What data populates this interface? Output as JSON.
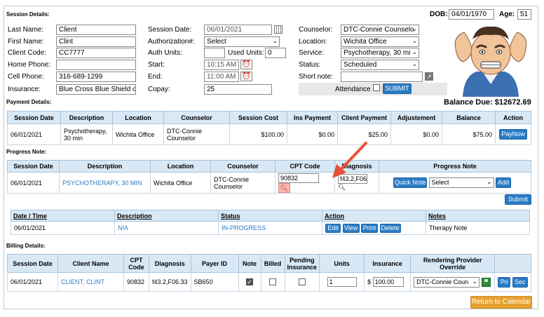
{
  "session": {
    "section_title": "Session Details:",
    "dob_label": "DOB:",
    "dob": "04/01/1970",
    "age_label": "Age:",
    "age": "51",
    "last_name_label": "Last Name:",
    "last_name": "Client",
    "first_name_label": "First Name:",
    "first_name": "Clint",
    "client_code_label": "Client Code:",
    "client_code": "CC7777",
    "home_phone_label": "Home Phone:",
    "home_phone": "",
    "cell_phone_label": "Cell Phone:",
    "cell_phone": "316-689-1299",
    "insurance_label": "Insurance:",
    "insurance": "Blue Cross Blue Shield of",
    "session_date_label": "Session Date:",
    "session_date": "06/01/2021",
    "authorization_label": "Authorization#:",
    "authorization": "Select",
    "auth_units_label": "Auth Units:",
    "auth_units": "",
    "used_units_label": "Used Units:",
    "used_units": "0",
    "start_label": "Start:",
    "start": "10:15 AM",
    "end_label": "End:",
    "end": "11:00 AM",
    "copay_label": "Copay:",
    "copay": "25",
    "counselor_label": "Counselor:",
    "counselor": "DTC-Connie Counselo",
    "location_label": "Location:",
    "location": "Wichita Office",
    "service_label": "Service:",
    "service": "Psychotherapy, 30 mi",
    "status_label": "Status:",
    "status": "Scheduled",
    "short_note_label": "Short note:",
    "short_note": "",
    "attendance_label": "Attendance",
    "submit": "SUBMIT"
  },
  "payment": {
    "section_title": "Payment Details:",
    "balance_due": "Balance Due: $12672.69",
    "headers": [
      "Session Date",
      "Description",
      "Location",
      "Counselor",
      "Session Cost",
      "Ins Payment",
      "Client Payment",
      "Adjustement",
      "Balance",
      "Action"
    ],
    "row": {
      "session_date": "06/01/2021",
      "description": "Psychotherapy, 30 min",
      "location": "Wichita Office",
      "counselor": "DTC-Connie Counselor",
      "session_cost": "$100.00",
      "ins_payment": "$0.00",
      "client_payment": "$25.00",
      "adjustment": "$0.00",
      "balance": "$75.00",
      "action": "PayNow"
    }
  },
  "progress": {
    "section_title": "Progress Note:",
    "headers": [
      "Session Date",
      "Description",
      "Location",
      "Counselor",
      "CPT Code",
      "Diagnosis",
      "Progress Note"
    ],
    "row": {
      "session_date": "06/01/2021",
      "description": "PSYCHOTHERAPY, 30 MIN",
      "location": "Wichita Office",
      "counselor": "DTC-Connie Counselor",
      "cpt_code": "90832",
      "diagnosis": "f43.2,F06",
      "quick_note": "Quick Note",
      "select": "Select",
      "add": "Add"
    },
    "submit": "Submit",
    "notes_headers": [
      "Date / Time",
      "Description",
      "Status",
      "Action",
      "Notes"
    ],
    "notes_row": {
      "datetime": "06/01/2021",
      "description": "N/A",
      "status": "IN-PROGRESS",
      "edit": "Edit",
      "view": "View",
      "print": "Print",
      "delete": "Delete",
      "notes": "Therapy Note"
    }
  },
  "billing": {
    "section_title": "Billing Details:",
    "headers": [
      "Session Date",
      "Client Name",
      "CPT Code",
      "Diagnosis",
      "Payer ID",
      "Note",
      "Billed",
      "Pending Insurance",
      "Units",
      "Insurance",
      "Rendering Provider Override"
    ],
    "row": {
      "session_date": "06/01/2021",
      "client_name": "CLIENT, CLINT",
      "cpt_code": "90832",
      "diagnosis": "f43.2,F06.33",
      "payer_id": "SB650",
      "note_checked": true,
      "billed_checked": false,
      "pending_checked": false,
      "units": "1",
      "insurance_prefix": "$",
      "insurance": "100.00",
      "provider": "DTC-Connie Coun",
      "pri": "Pri",
      "sec": "Sec"
    }
  },
  "return_button": "Return to Calendar",
  "colors": {
    "accent": "#2a7bc4",
    "header_bg": "#d9e8f5",
    "arrow": "#e8503a",
    "return_btn": "#e6a131",
    "highlight_btn": "#f6b6b0"
  }
}
